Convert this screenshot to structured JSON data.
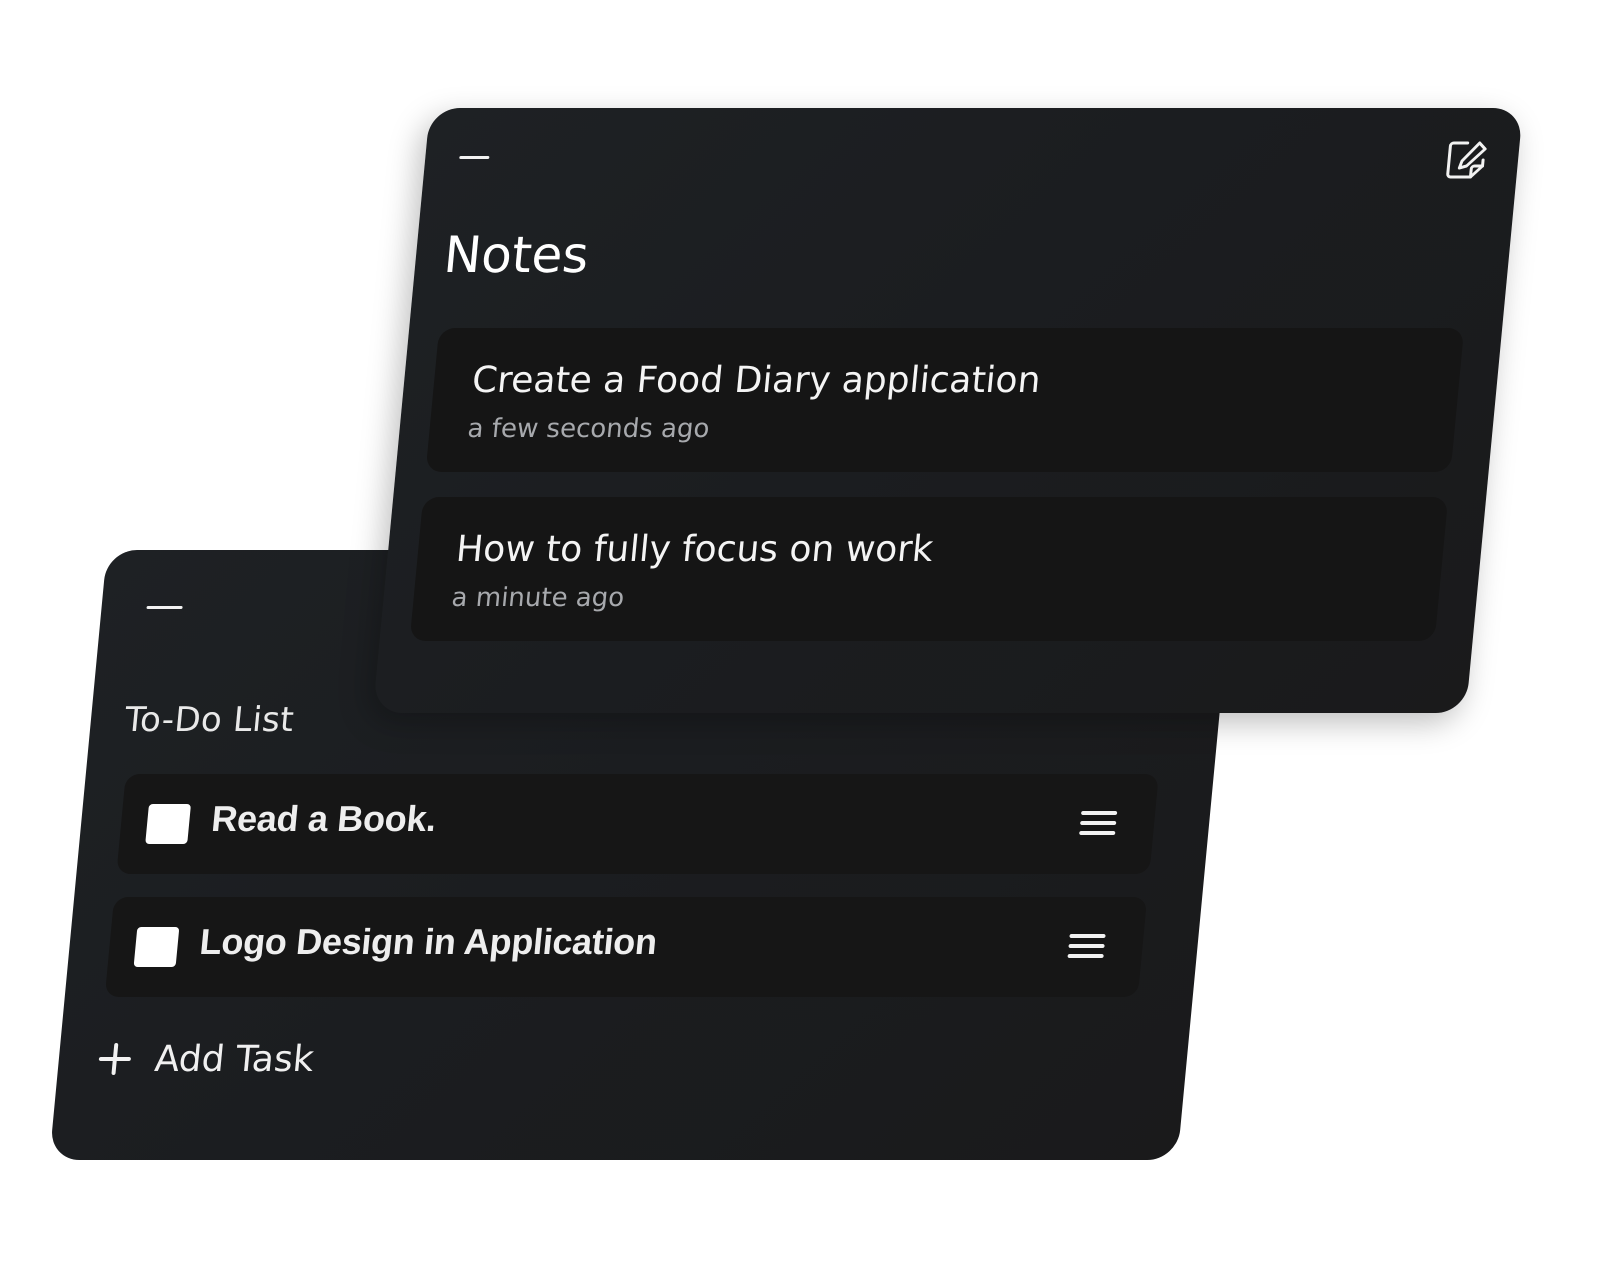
{
  "todo": {
    "title": "To-Do List",
    "tasks": [
      {
        "label": "Read a Book.",
        "checked": false
      },
      {
        "label": "Logo Design in Application",
        "checked": false
      }
    ],
    "add_task_label": "Add Task",
    "icons": {
      "minimize": "minimize-icon",
      "drag": "menu-icon",
      "add": "plus-icon"
    }
  },
  "notes": {
    "title": "Notes",
    "items": [
      {
        "title": "Create a Food Diary application",
        "time": "a few seconds ago"
      },
      {
        "title": "How to fully focus on work",
        "time": "a minute ago"
      }
    ],
    "icons": {
      "minimize": "minimize-icon",
      "new_note": "edit-icon"
    }
  },
  "colors": {
    "card_bg": "#1c1e21",
    "item_bg": "#161616",
    "text_primary": "#f2f2f2",
    "text_secondary": "#a7a9ad",
    "page_bg": "#ffffff"
  }
}
